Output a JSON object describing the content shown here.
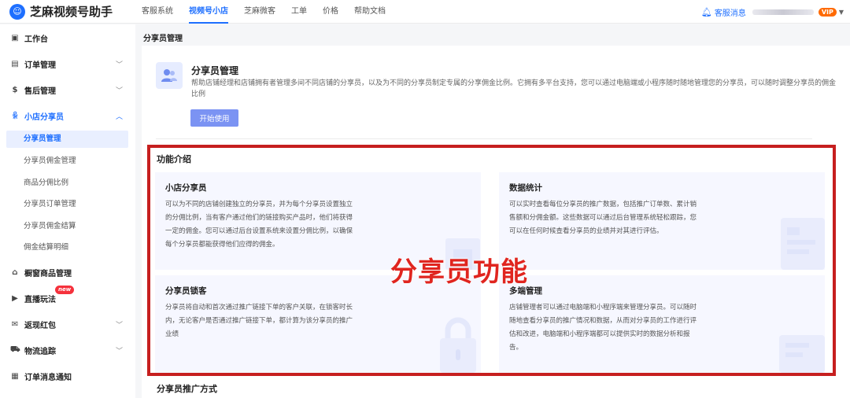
{
  "app": {
    "name": "芝麻视频号助手"
  },
  "topnav": {
    "items": [
      {
        "label": "客服系统",
        "active": false
      },
      {
        "label": "视频号小店",
        "active": true
      },
      {
        "label": "芝麻微客",
        "active": false
      },
      {
        "label": "工单",
        "active": false
      },
      {
        "label": "价格",
        "active": false
      },
      {
        "label": "帮助文档",
        "active": false
      }
    ],
    "service_msg": "客服消息",
    "vip_label": "VIP"
  },
  "sidebar": {
    "workbench": "工作台",
    "orders": "订单管理",
    "aftersale": "售后管理",
    "sharers": "小店分享员",
    "subs": [
      {
        "label": "分享员管理",
        "active": true
      },
      {
        "label": "分享员佣金管理",
        "active": false
      },
      {
        "label": "商品分佣比例",
        "active": false
      },
      {
        "label": "分享员订单管理",
        "active": false
      },
      {
        "label": "分享员佣金结算",
        "active": false
      },
      {
        "label": "佣金结算明细",
        "active": false
      }
    ],
    "showcase": "橱窗商品管理",
    "live": "直播玩法",
    "live_badge": "new",
    "redpacket": "返现红包",
    "logistics": "物流追踪",
    "notify": "订单消息通知"
  },
  "breadcrumb": "分享员管理",
  "intro": {
    "title": "分享员管理",
    "desc": "帮助店铺经理和店铺拥有者管理多间不同店铺的分享员，以及为不同的分享员制定专属的分享佣金比例。它拥有多平台支持，您可以通过电脑端或小程序随时随地管理您的分享员，可以随时调整分享员的佣金比例",
    "button": "开始使用"
  },
  "features": {
    "title": "功能介绍",
    "cards": [
      {
        "title": "小店分享员",
        "desc": "可以为不同的店铺创建独立的分享员，并为每个分享员设置独立的分佣比例，当有客户通过他们的链接购买产品时，他们将获得一定的佣金。您可以通过后台设置系统来设置分佣比例，以确保每个分享员都能获得他们应得的佣金。"
      },
      {
        "title": "数据统计",
        "desc": "可以实时查看每位分享员的推广数据，包括推广订单数、累计销售额和分佣金额。这些数据可以通过后台管理系统轻松跟踪，您可以在任何时候查看分享员的业绩并对其进行评估。"
      },
      {
        "title": "分享员锁客",
        "desc": "分享员将自动和首次通过推广链接下单的客户关联，在锁客时长内，无论客户是否通过推广链接下单，都计算为该分享员的推广业绩"
      },
      {
        "title": "多端管理",
        "desc": "店铺管理者可以通过电脑端和小程序端来管理分享员。可以随时随地查看分享员的推广情况和数据，从而对分享员的工作进行评估和改进，电脑端和小程序端都可以提供实时的数据分析和报告。"
      }
    ]
  },
  "overlay": "分享员功能",
  "promo": {
    "title": "分享员推广方式"
  }
}
